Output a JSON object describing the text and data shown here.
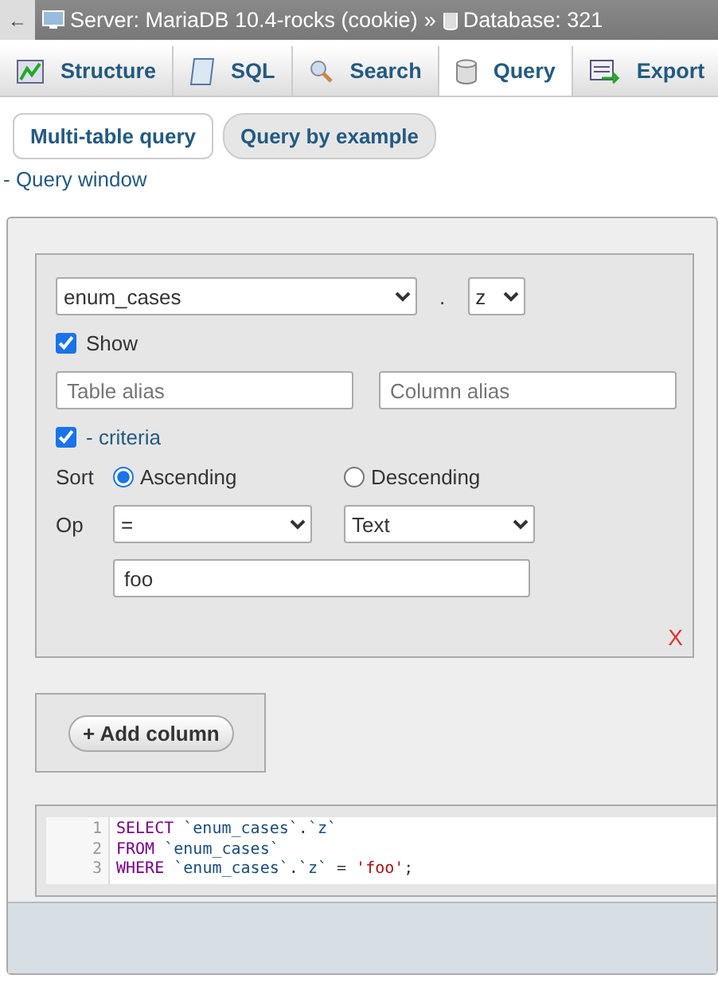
{
  "breadcrumb": {
    "back": "←",
    "server": "Server: MariaDB 10.4-rocks (cookie)",
    "separator": "»",
    "database": "Database: 321"
  },
  "tabs": [
    {
      "label": "Structure",
      "kind": "structure",
      "selected": false
    },
    {
      "label": "SQL",
      "kind": "sql",
      "selected": false
    },
    {
      "label": "Search",
      "kind": "search",
      "selected": false
    },
    {
      "label": "Query",
      "kind": "query",
      "selected": true
    },
    {
      "label": "Export",
      "kind": "export",
      "selected": false
    }
  ],
  "subtabs": [
    {
      "label": "Multi-table query",
      "selected": false
    },
    {
      "label": "Query by example",
      "selected": true
    }
  ],
  "query_window_link": "- Query window",
  "criteria_box": {
    "table": "enum_cases",
    "dot": ".",
    "column": "z",
    "show": {
      "label": "Show",
      "checked": true
    },
    "table_alias": {
      "placeholder": "Table alias"
    },
    "column_alias": {
      "placeholder": "Column alias"
    },
    "criteria": {
      "label": "- criteria",
      "checked": true
    },
    "sort_label": "Sort",
    "sort_options": [
      {
        "label": "Ascending",
        "selected": true
      },
      {
        "label": "Descending",
        "selected": false
      }
    ],
    "op_label": "Op",
    "operator": "=",
    "value_type": "Text",
    "value": "foo",
    "remove": "X"
  },
  "add_column": "+ Add column",
  "sql": [
    {
      "number": "1",
      "tokens": [
        {
          "kind": "keyword",
          "text": "SELECT"
        },
        {
          "kind": "name",
          "text": " `enum_cases`"
        },
        {
          "kind": "punct",
          "text": "."
        },
        {
          "kind": "name",
          "text": "`z`"
        }
      ]
    },
    {
      "number": "2",
      "tokens": [
        {
          "kind": "keyword",
          "text": "FROM"
        },
        {
          "kind": "name",
          "text": " `enum_cases`"
        }
      ]
    },
    {
      "number": "3",
      "tokens": [
        {
          "kind": "keyword",
          "text": "WHERE"
        },
        {
          "kind": "name",
          "text": " `enum_cases`"
        },
        {
          "kind": "punct",
          "text": "."
        },
        {
          "kind": "name",
          "text": "`z`"
        },
        {
          "kind": "punct",
          "text": " = "
        },
        {
          "kind": "string",
          "text": "'foo'"
        },
        {
          "kind": "punct",
          "text": ";"
        }
      ]
    }
  ]
}
